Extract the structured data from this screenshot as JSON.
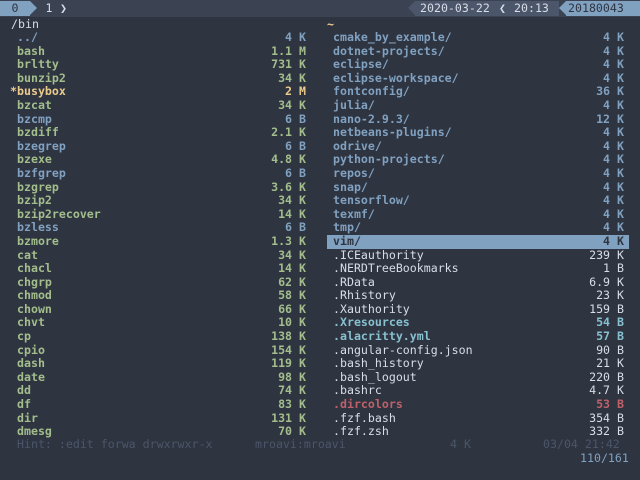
{
  "topbar": {
    "active_tab": "0",
    "idle_tab": "1",
    "date": "2020-03-22",
    "time": "20:13",
    "host": "20180043"
  },
  "left_pane": {
    "path": "/bin",
    "rows": [
      {
        "name": "../",
        "size": "4 K",
        "kind": "dir"
      },
      {
        "name": "bash",
        "size": "1.1 M",
        "kind": "exec"
      },
      {
        "name": "brltty",
        "size": "731 K",
        "kind": "exec"
      },
      {
        "name": "bunzip2",
        "size": "34 K",
        "kind": "exec"
      },
      {
        "name": "busybox",
        "size": "2 M",
        "kind": "tagged",
        "mark": "*"
      },
      {
        "name": "bzcat",
        "size": "34 K",
        "kind": "exec"
      },
      {
        "name": "bzcmp",
        "size": "6 B",
        "kind": "dir"
      },
      {
        "name": "bzdiff",
        "size": "2.1 K",
        "kind": "exec"
      },
      {
        "name": "bzegrep",
        "size": "6 B",
        "kind": "dir"
      },
      {
        "name": "bzexe",
        "size": "4.8 K",
        "kind": "exec"
      },
      {
        "name": "bzfgrep",
        "size": "6 B",
        "kind": "dir"
      },
      {
        "name": "bzgrep",
        "size": "3.6 K",
        "kind": "exec"
      },
      {
        "name": "bzip2",
        "size": "34 K",
        "kind": "exec"
      },
      {
        "name": "bzip2recover",
        "size": "14 K",
        "kind": "exec"
      },
      {
        "name": "bzless",
        "size": "6 B",
        "kind": "dir"
      },
      {
        "name": "bzmore",
        "size": "1.3 K",
        "kind": "exec"
      },
      {
        "name": "cat",
        "size": "34 K",
        "kind": "exec"
      },
      {
        "name": "chacl",
        "size": "14 K",
        "kind": "exec"
      },
      {
        "name": "chgrp",
        "size": "62 K",
        "kind": "exec"
      },
      {
        "name": "chmod",
        "size": "58 K",
        "kind": "exec"
      },
      {
        "name": "chown",
        "size": "66 K",
        "kind": "exec"
      },
      {
        "name": "chvt",
        "size": "10 K",
        "kind": "exec"
      },
      {
        "name": "cp",
        "size": "138 K",
        "kind": "exec"
      },
      {
        "name": "cpio",
        "size": "154 K",
        "kind": "exec"
      },
      {
        "name": "dash",
        "size": "119 K",
        "kind": "exec"
      },
      {
        "name": "date",
        "size": "98 K",
        "kind": "exec"
      },
      {
        "name": "dd",
        "size": "74 K",
        "kind": "exec"
      },
      {
        "name": "df",
        "size": "83 K",
        "kind": "exec"
      },
      {
        "name": "dir",
        "size": "131 K",
        "kind": "exec"
      },
      {
        "name": "dmesg",
        "size": "70 K",
        "kind": "exec"
      }
    ]
  },
  "right_pane": {
    "path": "~",
    "rows": [
      {
        "name": "cmake_by_example/",
        "size": "4 K",
        "kind": "dir"
      },
      {
        "name": "dotnet-projects/",
        "size": "4 K",
        "kind": "dir"
      },
      {
        "name": "eclipse/",
        "size": "4 K",
        "kind": "dir"
      },
      {
        "name": "eclipse-workspace/",
        "size": "4 K",
        "kind": "dir"
      },
      {
        "name": "fontconfig/",
        "size": "36 K",
        "kind": "dir"
      },
      {
        "name": "julia/",
        "size": "4 K",
        "kind": "dir"
      },
      {
        "name": "nano-2.9.3/",
        "size": "12 K",
        "kind": "dir"
      },
      {
        "name": "netbeans-plugins/",
        "size": "4 K",
        "kind": "dir"
      },
      {
        "name": "odrive/",
        "size": "4 K",
        "kind": "dir"
      },
      {
        "name": "python-projects/",
        "size": "4 K",
        "kind": "dir"
      },
      {
        "name": "repos/",
        "size": "4 K",
        "kind": "dir"
      },
      {
        "name": "snap/",
        "size": "4 K",
        "kind": "dir"
      },
      {
        "name": "tensorflow/",
        "size": "4 K",
        "kind": "dir"
      },
      {
        "name": "texmf/",
        "size": "4 K",
        "kind": "dir"
      },
      {
        "name": "tmp/",
        "size": "4 K",
        "kind": "dir"
      },
      {
        "name": "vim/",
        "size": "4 K",
        "kind": "dir",
        "selected": true
      },
      {
        "name": ".ICEauthority",
        "size": "239 K",
        "kind": "file"
      },
      {
        "name": ".NERDTreeBookmarks",
        "size": "1 B",
        "kind": "file"
      },
      {
        "name": ".RData",
        "size": "6.9 K",
        "kind": "file"
      },
      {
        "name": ".Rhistory",
        "size": "23 K",
        "kind": "file"
      },
      {
        "name": ".Xauthority",
        "size": "159 B",
        "kind": "file"
      },
      {
        "name": ".Xresources",
        "size": "54 B",
        "kind": "boldfile"
      },
      {
        "name": ".alacritty.yml",
        "size": "57 B",
        "kind": "boldfile"
      },
      {
        "name": ".angular-config.json",
        "size": "90 B",
        "kind": "file"
      },
      {
        "name": ".bash_history",
        "size": "21 K",
        "kind": "file"
      },
      {
        "name": ".bash_logout",
        "size": "220 B",
        "kind": "file"
      },
      {
        "name": ".bashrc",
        "size": "4.7 K",
        "kind": "file"
      },
      {
        "name": ".dircolors",
        "size": "53 B",
        "kind": "red"
      },
      {
        "name": ".fzf.bash",
        "size": "354 B",
        "kind": "file"
      },
      {
        "name": ".fzf.zsh",
        "size": "332 B",
        "kind": "file"
      }
    ]
  },
  "status": {
    "hint": "Hint: :edit forwa drwxrwxr-x",
    "owner": "mroavi:mroavi",
    "size": "4 K",
    "mtime": "03/04 21:42",
    "position": "110/161"
  },
  "colors": {
    "background": "#2e3440",
    "accent": "#81a1c1",
    "directory": "#81a1c1",
    "executable": "#a3be8c",
    "tagged": "#ebcb8b",
    "special": "#bf616a"
  }
}
